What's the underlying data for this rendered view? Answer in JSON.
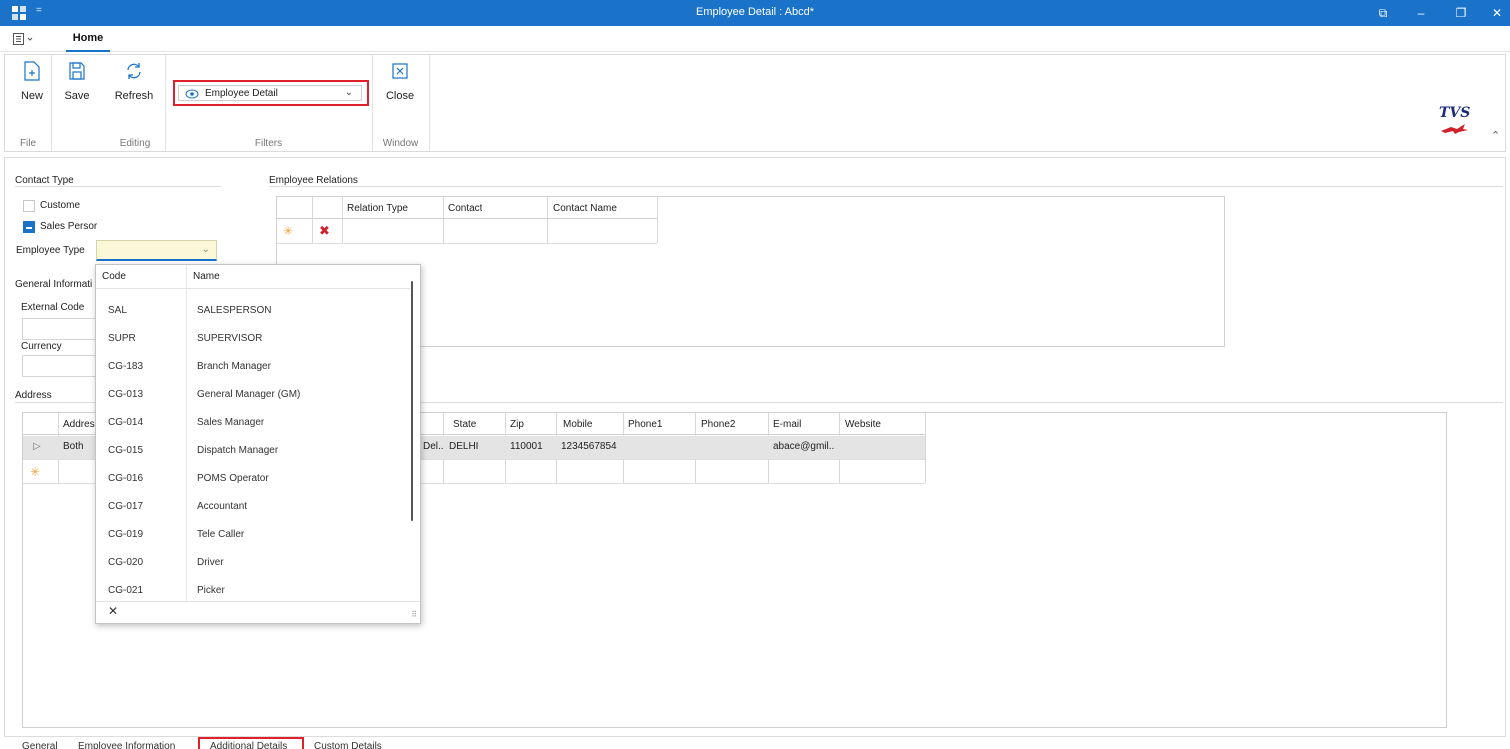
{
  "window": {
    "title": "Employee Detail : Abcd*",
    "qa_symbol": "=",
    "controls": {
      "restore": "⧉",
      "minimize": "–",
      "maximize": "❐",
      "close": "✕"
    }
  },
  "ribbon": {
    "tab_home": "Home",
    "buttons": {
      "new": "New",
      "save": "Save",
      "refresh": "Refresh",
      "close": "Close"
    },
    "groups": {
      "file": "File",
      "editing": "Editing",
      "filters": "Filters",
      "window": "Window"
    },
    "filter_value": "Employee Detail",
    "logo": "TVS"
  },
  "contact_type": {
    "label": "Contact Type",
    "customer": "Custome",
    "sales_person": "Sales Persor",
    "employee_type_label": "Employee Type"
  },
  "general_info": {
    "label": "General Informati",
    "external_code": "External Code",
    "currency": "Currency"
  },
  "employee_relations": {
    "label": "Employee Relations",
    "columns": [
      "Relation Type",
      "Contact",
      "Contact Name"
    ]
  },
  "address": {
    "label": "Address",
    "columns": [
      "Addres",
      "State",
      "Zip",
      "Mobile",
      "Phone1",
      "Phone2",
      "E-mail",
      "Website"
    ],
    "row": {
      "address": "Both",
      "city_partial": "Del..",
      "state": "DELHI",
      "zip": "110001",
      "mobile": "1234567854",
      "phone1": "",
      "phone2": "",
      "email": "abace@gmil..",
      "website": ""
    }
  },
  "dropdown": {
    "col_code": "Code",
    "col_name": "Name",
    "rows": [
      {
        "code": "SAL",
        "name": "SALESPERSON"
      },
      {
        "code": "SUPR",
        "name": "SUPERVISOR"
      },
      {
        "code": "CG-183",
        "name": "Branch Manager"
      },
      {
        "code": "CG-013",
        "name": "General Manager (GM)"
      },
      {
        "code": "CG-014",
        "name": "Sales Manager"
      },
      {
        "code": "CG-015",
        "name": "Dispatch Manager"
      },
      {
        "code": "CG-016",
        "name": "POMS Operator"
      },
      {
        "code": "CG-017",
        "name": "Accountant"
      },
      {
        "code": "CG-019",
        "name": "Tele Caller"
      },
      {
        "code": "CG-020",
        "name": "Driver"
      },
      {
        "code": "CG-021",
        "name": "Picker"
      }
    ],
    "close": "✕"
  },
  "bottom_tabs": [
    "General",
    "Employee Information",
    "Additional Details",
    "Custom Details"
  ],
  "colors": {
    "accent": "#1a73c9",
    "highlight_border": "#e0202a",
    "required_field": "#fbf8da"
  }
}
